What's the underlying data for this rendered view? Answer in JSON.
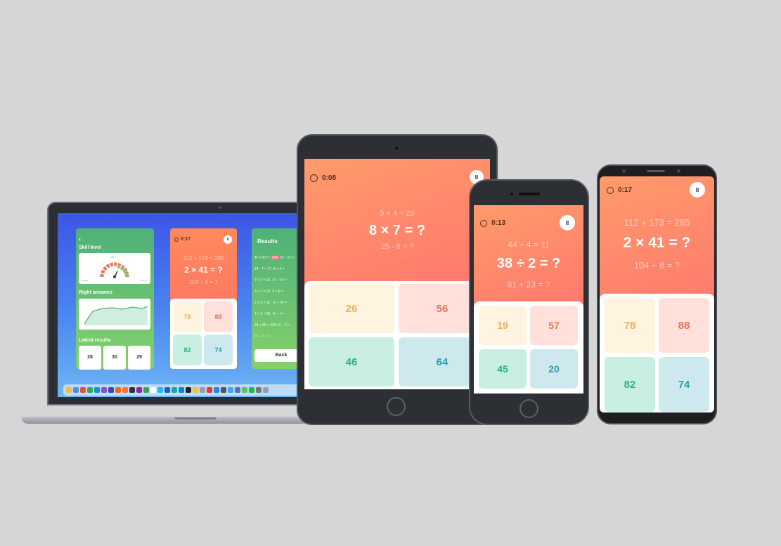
{
  "laptop": {
    "skill_panel": {
      "back": "‹",
      "skill_title": "Skill level",
      "gauge_value": "327",
      "gauge_min": "Newbie",
      "gauge_max": "Expert",
      "right_answers_title": "Right answers",
      "latest_title": "Latest results",
      "latest": [
        "28",
        "30",
        "29"
      ]
    },
    "game_panel": {
      "timer": "0:17",
      "pause": "II",
      "prev_eq": "112 + 173 = 285",
      "current_eq": "2 × 41 = ?",
      "next_eq": "104 ÷ 8 = ?",
      "answers": [
        "78",
        "88",
        "82",
        "74"
      ]
    },
    "results_panel": {
      "title": "Results",
      "rows": [
        [
          "47 + 87 = ",
          "164",
          "60 · 83 = "
        ],
        [
          "24 · 7 = 17",
          "8 + 4 ="
        ],
        [
          "7 × 3 = 21",
          "36 ÷ 90 ="
        ],
        [
          "3 × 7 = 21",
          "3 × 9 ="
        ],
        [
          "2 × 5 = 10",
          "76 ÷ 40 ="
        ],
        [
          "7 × 3 = 21",
          "45 ÷ 9 ="
        ],
        [
          "64 + 65 = 129",
          "36 ÷ 9 ="
        ],
        [
          "40 ÷ 5 = 8",
          ""
        ]
      ],
      "button": "Back"
    }
  },
  "ipad": {
    "timer": "0:08",
    "pause": "II",
    "prev_eq": "5 × 4 = 20",
    "current_eq": "8 × 7 = ?",
    "next_eq": "25 - 8 = ?",
    "answers": [
      "26",
      "56",
      "46",
      "64"
    ]
  },
  "iphone": {
    "timer": "0:13",
    "pause": "II",
    "prev_eq": "44 ÷ 4 = 11",
    "current_eq": "38 ÷ 2 = ?",
    "next_eq": "81 + 23 = ?",
    "answers": [
      "19",
      "57",
      "45",
      "20"
    ]
  },
  "android": {
    "timer": "0:17",
    "pause": "II",
    "prev_eq": "112 + 173 = 285",
    "current_eq": "2 × 41 = ?",
    "next_eq": "104 ÷ 8 = ?",
    "answers": [
      "78",
      "88",
      "82",
      "74"
    ]
  },
  "colors": {
    "background": "#d6d6d6",
    "game_gradient_start": "#ff9b6a",
    "game_gradient_end": "#ff6d70",
    "answer_yellow": "#e5b25c",
    "answer_red": "#e9735c",
    "answer_green": "#2bb08a",
    "answer_blue": "#2a9bb0"
  },
  "icons": [
    "timer-icon",
    "pause-icon",
    "home-button",
    "gauge-icon"
  ]
}
